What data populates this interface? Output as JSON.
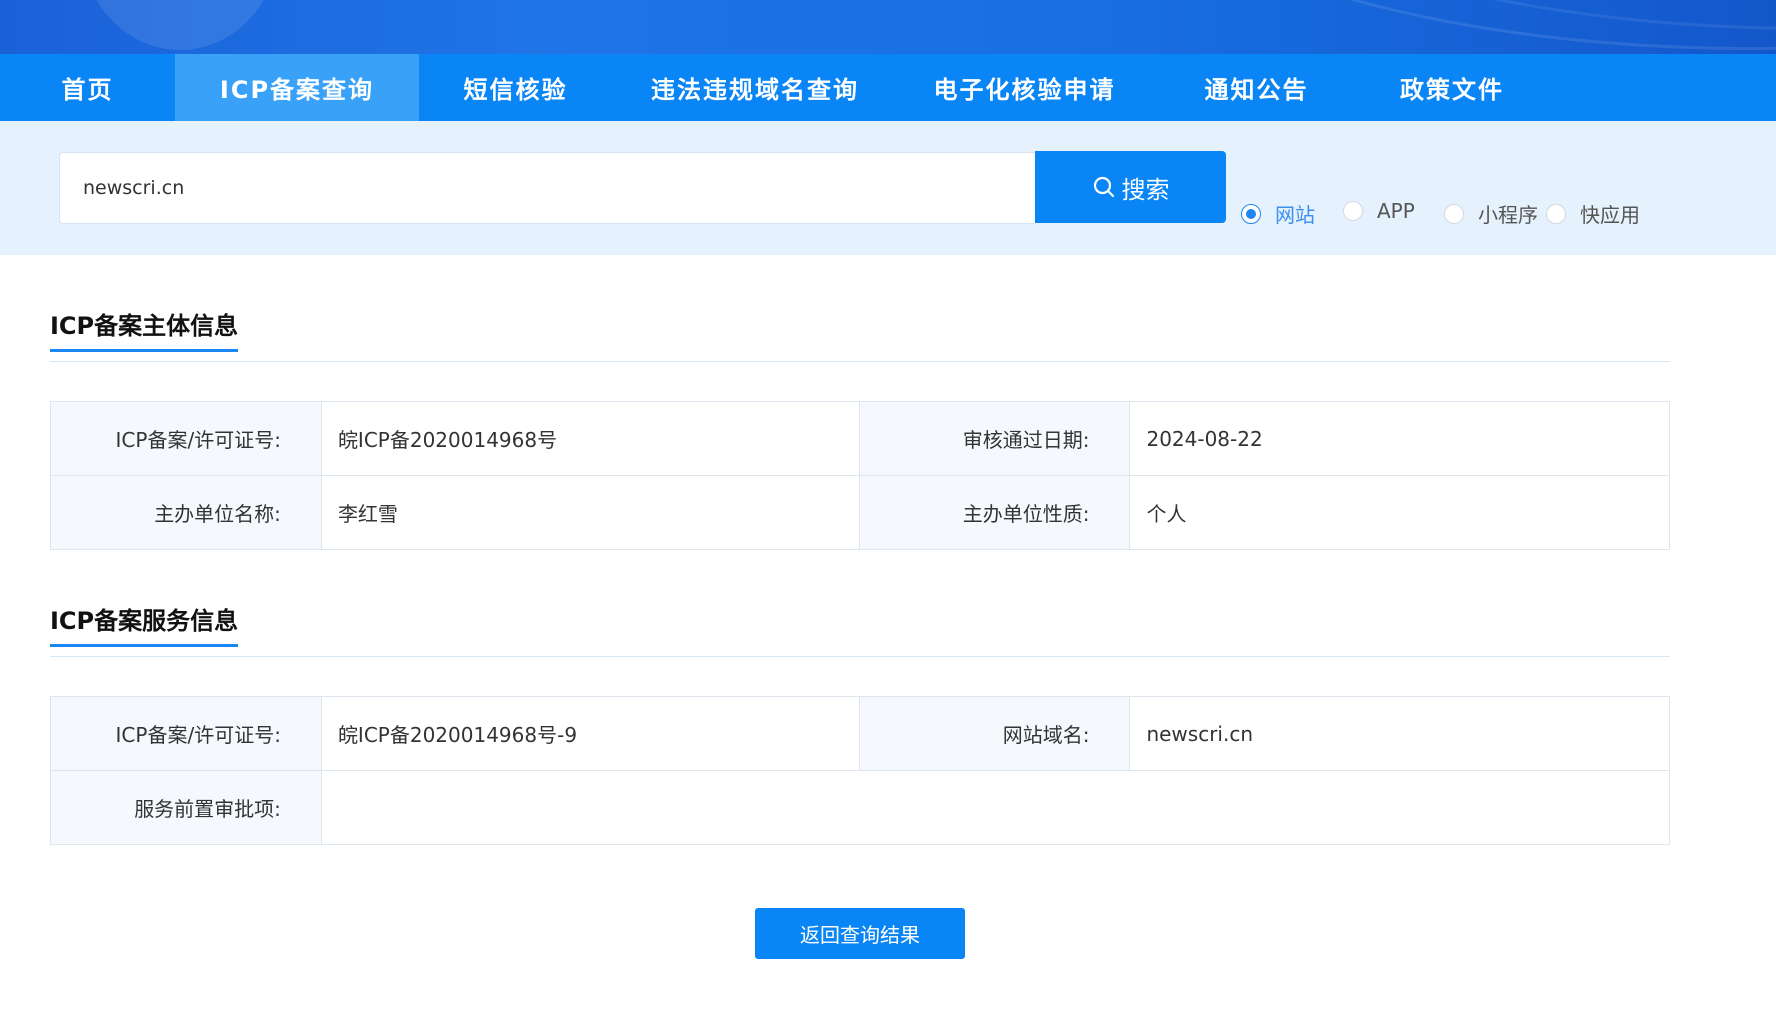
{
  "colors": {
    "primary": "#0a85f5",
    "nav_active": "#3aa1f8",
    "search_band": "#e5f1fd",
    "label_bg": "#f5f9fd"
  },
  "nav": {
    "items": [
      {
        "label": "首页",
        "active": false
      },
      {
        "label": "ICP备案查询",
        "active": true
      },
      {
        "label": "短信核验",
        "active": false
      },
      {
        "label": "违法违规域名查询",
        "active": false
      },
      {
        "label": "电子化核验申请",
        "active": false
      },
      {
        "label": "通知公告",
        "active": false
      },
      {
        "label": "政策文件",
        "active": false
      }
    ]
  },
  "search": {
    "value": "newscri.cn",
    "button_label": "搜索",
    "button_icon": "search-icon",
    "types": [
      {
        "label": "网站",
        "checked": true
      },
      {
        "label": "APP",
        "checked": false
      },
      {
        "label": "小程序",
        "checked": false
      },
      {
        "label": "快应用",
        "checked": false
      }
    ]
  },
  "subject": {
    "title": "ICP备案主体信息",
    "license_label": "ICP备案/许可证号:",
    "license_value": "皖ICP备2020014968号",
    "approve_date_label": "审核通过日期:",
    "approve_date_value": "2024-08-22",
    "org_name_label": "主办单位名称:",
    "org_name_value": "李红雪",
    "org_type_label": "主办单位性质:",
    "org_type_value": "个人"
  },
  "service": {
    "title": "ICP备案服务信息",
    "license_label": "ICP备案/许可证号:",
    "license_value": "皖ICP备2020014968号-9",
    "domain_label": "网站域名:",
    "domain_value": "newscri.cn",
    "preapproval_label": "服务前置审批项:",
    "preapproval_value": ""
  },
  "back_button_label": "返回查询结果"
}
